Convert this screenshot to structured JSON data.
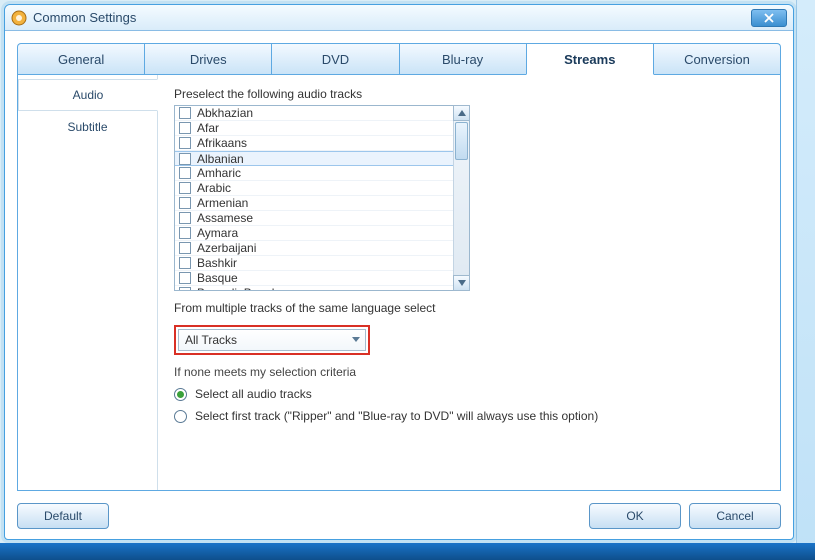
{
  "window": {
    "title": "Common Settings"
  },
  "tabs": [
    {
      "label": "General"
    },
    {
      "label": "Drives"
    },
    {
      "label": "DVD"
    },
    {
      "label": "Blu-ray"
    },
    {
      "label": "Streams",
      "active": true
    },
    {
      "label": "Conversion"
    }
  ],
  "sidebar": {
    "items": [
      {
        "label": "Audio",
        "active": true
      },
      {
        "label": "Subtitle"
      }
    ]
  },
  "audio": {
    "preselect_label": "Preselect the following audio tracks",
    "languages": [
      "Abkhazian",
      "Afar",
      "Afrikaans",
      "Albanian",
      "Amharic",
      "Arabic",
      "Armenian",
      "Assamese",
      "Aymara",
      "Azerbaijani",
      "Bashkir",
      "Basque",
      "Bengali; Bangla"
    ],
    "hover_index": 3,
    "multi_label": "From multiple tracks of the same language select",
    "dropdown_value": "All Tracks",
    "none_label": "If none meets my selection criteria",
    "radios": {
      "opt1": "Select all audio tracks",
      "opt2": "Select first track (\"Ripper\" and \"Blue-ray to DVD\" will always use this option)",
      "selected": 0
    }
  },
  "footer": {
    "default": "Default",
    "ok": "OK",
    "cancel": "Cancel"
  }
}
